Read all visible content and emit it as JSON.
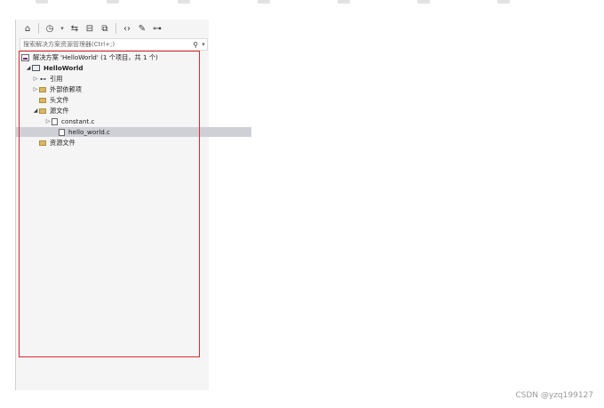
{
  "colors": {
    "panel_bg": "#f5f5f5",
    "selection": "#cfd0d6",
    "highlight_border": "#e2262d",
    "folder": "#d8b865"
  },
  "toolbar": {
    "icons": [
      "home-icon",
      "history-icon",
      "sync-icon",
      "collapse-all-icon",
      "show-all-files-icon",
      "code-view-icon",
      "properties-icon",
      "preview-icon"
    ]
  },
  "search": {
    "placeholder": "搜索解决方案资源管理器(Ctrl+;)"
  },
  "tree": {
    "solution": "解决方案 'HelloWorld' (1 个项目，共 1 个)",
    "project": "HelloWorld",
    "references": "引用",
    "external_deps": "外部依赖项",
    "headers": "头文件",
    "sources": "源文件",
    "file_constant": "constant.c",
    "file_hello": "hello_world.c",
    "resources": "资源文件"
  },
  "watermark": "CSDN @yzq199127"
}
